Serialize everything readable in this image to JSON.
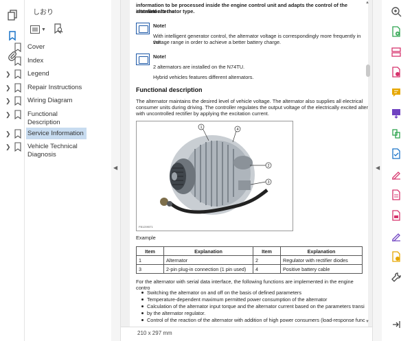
{
  "bookmarks_panel": {
    "title": "しおり",
    "items": [
      {
        "label": "Cover",
        "expandable": false
      },
      {
        "label": "Index",
        "expandable": false
      },
      {
        "label": "Legend",
        "expandable": true
      },
      {
        "label": "Repair Instructions",
        "expandable": true
      },
      {
        "label": "Wiring Diagram",
        "expandable": true
      },
      {
        "label": "Functional Description",
        "expandable": true
      },
      {
        "label": "Service Information",
        "expandable": true,
        "selected": true
      },
      {
        "label": "Vehicle Technical Diagnosis",
        "expandable": true
      }
    ]
  },
  "document": {
    "intro_line1": "information to be processed inside the engine control unit and adapts the control of the alternator to the",
    "intro_line2": "installed alternator type.",
    "note1": {
      "title": "Note!",
      "line1": "With intelligent generator control, the alternator voltage is correspondingly more frequently in the",
      "line2": "voltage range in order to achieve a better battery charge."
    },
    "note2": {
      "title": "Note!",
      "line1": "2 alternators are installed on the N74TU.",
      "line2": "Hybrid vehicles features different alternators."
    },
    "heading": "Functional description",
    "func_line1": "The alternator maintains the desired level of vehicle voltage. The alternator also supplies all electrical",
    "func_line2": "consumer units during driving. The controller regulates the output voltage of the electrically excited alter",
    "func_line3": "with uncontrolled rectifier by applying the excitation current.",
    "figure_code": "FB12095T1",
    "figure_callouts": [
      "1",
      "2",
      "3",
      "4"
    ],
    "example_label": "Example",
    "table": {
      "headers": [
        "Item",
        "Explanation",
        "Item",
        "Explanation"
      ],
      "rows": [
        [
          "1",
          "Alternator",
          "2",
          "Regulator with rectifier diodes"
        ],
        [
          "3",
          "2-pin plug-in connection (1 pin used)",
          "4",
          "Positive battery cable"
        ]
      ]
    },
    "serial_line": "For the alternator with serial data interface, the following functions are implemented in the engine contro",
    "bullets": [
      "Switching the alternator on and off on the basis of defined parameters",
      "Temperature-dependent maximum permitted power consumption of the alternator",
      "Calculation of the alternator input torque and the alternator current based on the parameters transi",
      "by the alternator regulator.",
      "Control of the reaction of the alternator with addition of high power consumers (load-response func"
    ]
  },
  "status": {
    "page_size": "210 x 297 mm"
  },
  "colors": {
    "accent": "#1a73c8",
    "selected_bg": "#c8dcf0",
    "note_icon": "#1a56a6",
    "tool_colors": [
      "#555555",
      "#2ea44f",
      "#d6336c",
      "#d6336c",
      "#e6a700",
      "#6f42c1",
      "#2ea44f",
      "#1a73c8",
      "#d6336c",
      "#d6336c",
      "#d6336c",
      "#6f42c1",
      "#e6a700",
      "#444444"
    ]
  }
}
